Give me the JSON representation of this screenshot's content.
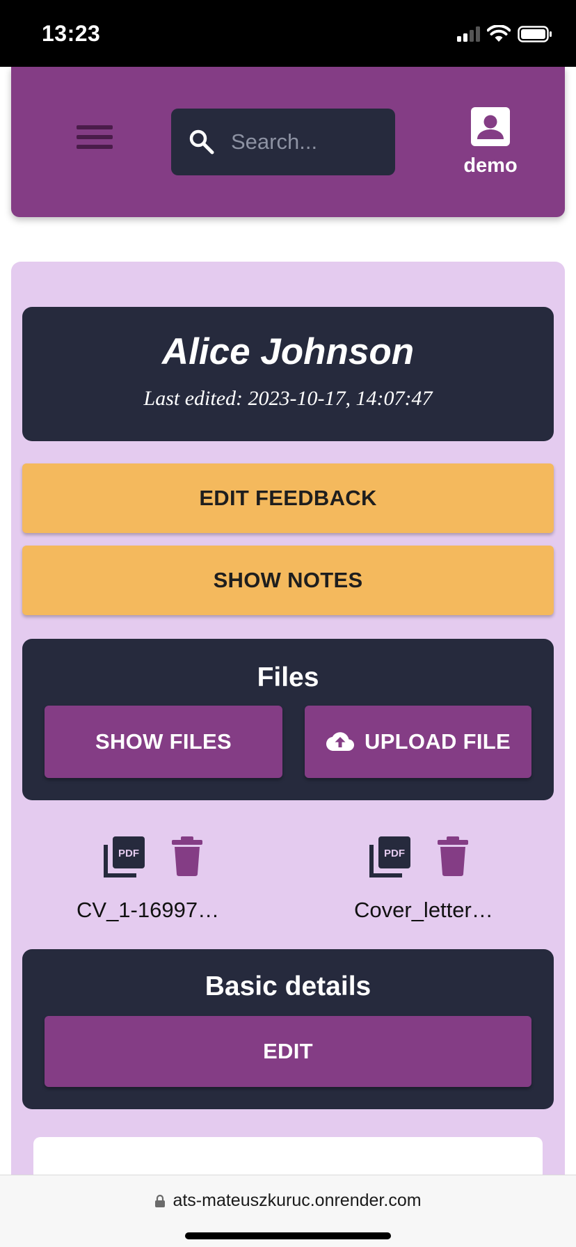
{
  "status_bar": {
    "time": "13:23"
  },
  "header": {
    "search": {
      "placeholder": "Search..."
    },
    "user": {
      "name": "demo"
    }
  },
  "candidate": {
    "name": "Alice Johnson",
    "last_edited": "Last edited: 2023-10-17, 14:07:47"
  },
  "actions": {
    "edit_feedback": "EDIT FEEDBACK",
    "show_notes": "SHOW NOTES"
  },
  "files": {
    "title": "Files",
    "show_files": "SHOW FILES",
    "upload_file": "UPLOAD FILE",
    "items": [
      {
        "name": "CV_1-16997…",
        "icon": "pdf-icon"
      },
      {
        "name": "Cover_letter…",
        "icon": "pdf-icon"
      }
    ]
  },
  "basic_details": {
    "title": "Basic details",
    "edit": "EDIT"
  },
  "browser": {
    "url": "ats-mateuszkuruc.onrender.com"
  },
  "colors": {
    "header_purple": "#843d85",
    "panel_lilac": "#e4cbef",
    "card_navy": "#262a3d",
    "button_yellow": "#f4b95d"
  }
}
